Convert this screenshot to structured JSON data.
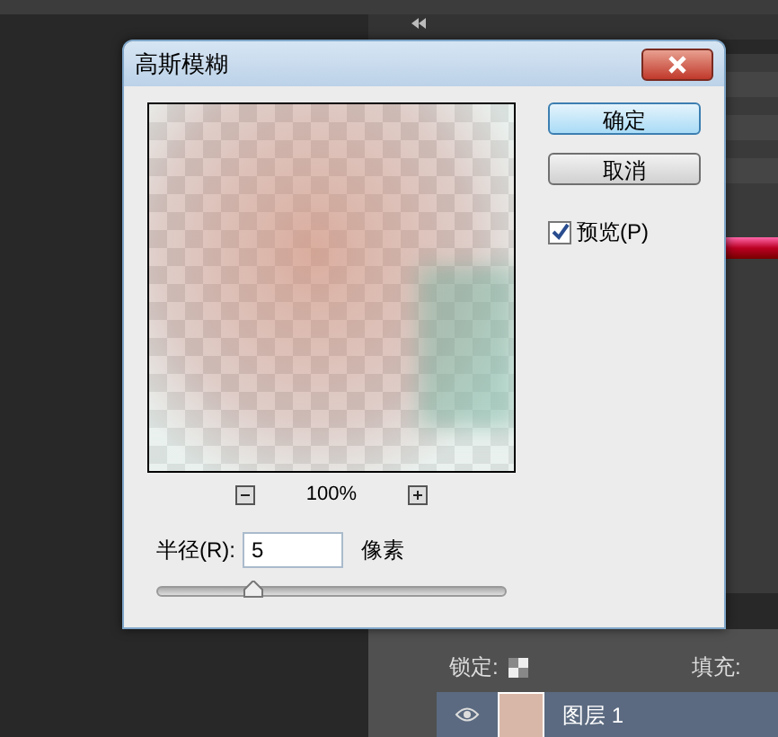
{
  "dialog": {
    "title": "高斯模糊",
    "zoom": "100%",
    "buttons": [
      {
        "label": "确定",
        "default": true
      },
      {
        "label": "取消",
        "default": false
      }
    ],
    "preview": {
      "label": "预览(P)",
      "checked": true
    },
    "radius": {
      "label": "半径(R):",
      "value": "5",
      "unit": "像素",
      "level": 0.27
    }
  },
  "layers_panel": {
    "lock_label": "锁定:",
    "fill_label": "填充:",
    "layers": [
      {
        "name": "图层 1",
        "selected": true
      }
    ]
  }
}
